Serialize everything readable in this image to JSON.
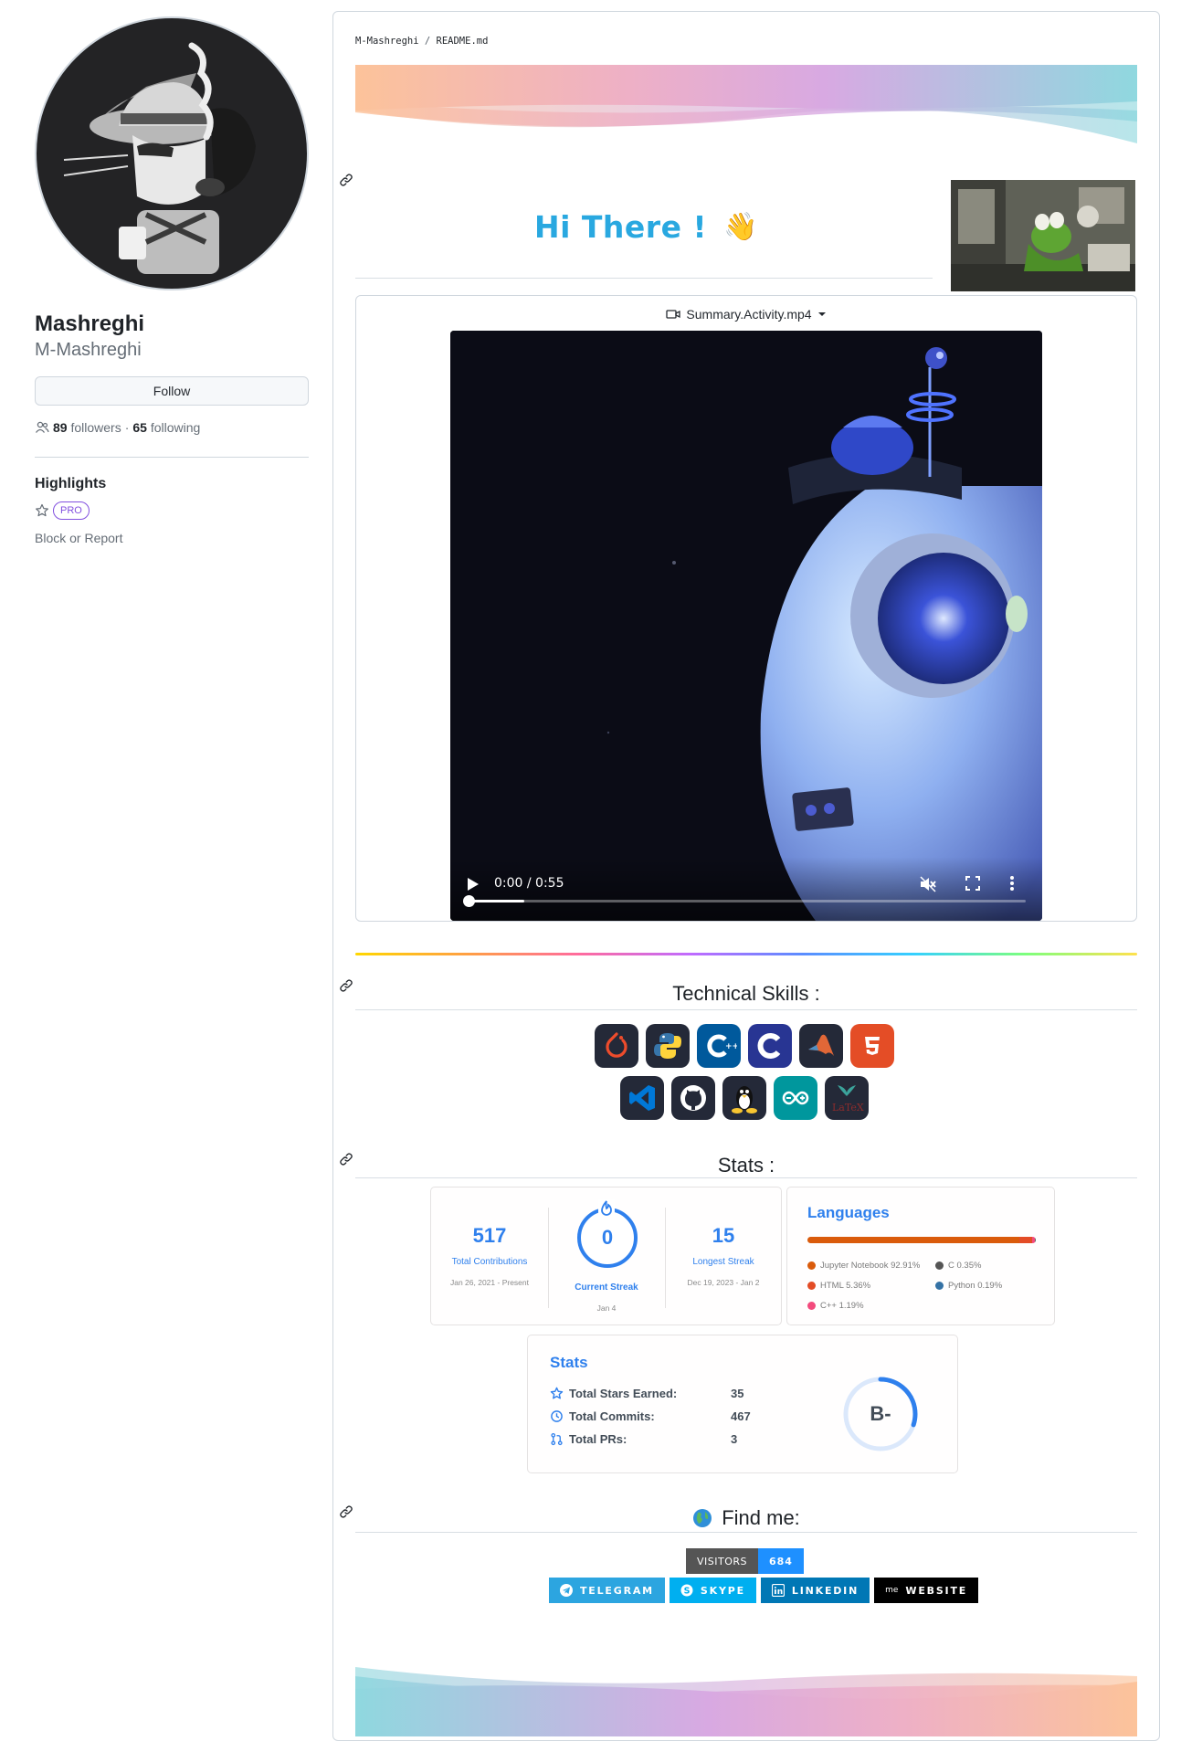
{
  "profile": {
    "name": "Mashreghi",
    "login": "M-Mashreghi",
    "follow_label": "Follow",
    "followers_count": "89",
    "followers_label": "followers",
    "separator": "·",
    "following_count": "65",
    "following_label": "following",
    "highlights_title": "Highlights",
    "pro_badge": "PRO",
    "block_report": "Block or Report"
  },
  "readme": {
    "breadcrumb_owner": "M-Mashreghi",
    "breadcrumb_sep": " / ",
    "breadcrumb_file": "README.md",
    "greeting": "Hi There !",
    "greeting_emoji": "👋",
    "video": {
      "filename": "Summary.Activity.mp4",
      "time": "0:00 / 0:55",
      "progress": 0.1
    },
    "skills_title": "Technical Skills :",
    "skills_row1": [
      "pytorch",
      "python",
      "cpp",
      "c",
      "matlab",
      "html5"
    ],
    "skills_row2": [
      "vscode",
      "github",
      "linux",
      "arduino",
      "latex"
    ],
    "stats_title": "Stats :",
    "streak": {
      "total_contributions": "517",
      "total_contributions_label": "Total Contributions",
      "total_contributions_range": "Jan 26, 2021 - Present",
      "current_streak": "0",
      "current_streak_label": "Current Streak",
      "current_streak_range": "Jan 4",
      "longest_streak": "15",
      "longest_streak_label": "Longest Streak",
      "longest_streak_range": "Dec 19, 2023 - Jan 2"
    },
    "languages": {
      "title": "Languages",
      "items": [
        {
          "name": "Jupyter Notebook 92.91%",
          "percent": 92.91,
          "color": "#DA5B0B"
        },
        {
          "name": "HTML 5.36%",
          "percent": 5.36,
          "color": "#E34C26"
        },
        {
          "name": "C++ 1.19%",
          "percent": 1.19,
          "color": "#F34B7D"
        },
        {
          "name": "C 0.35%",
          "percent": 0.35,
          "color": "#555555"
        },
        {
          "name": "Python 0.19%",
          "percent": 0.19,
          "color": "#3572A5"
        }
      ]
    },
    "github_stats": {
      "title": "Stats",
      "stars_label": "Total Stars Earned:",
      "stars_value": "35",
      "commits_label": "Total Commits:",
      "commits_value": "467",
      "prs_label": "Total PRs:",
      "prs_value": "3",
      "grade": "B-",
      "grade_progress": 0.3
    },
    "findme_title": "Find me:",
    "visitors_label": "VISITORS",
    "visitors_value": "684",
    "social": [
      {
        "label": "TELEGRAM",
        "color": "#2CA5E0"
      },
      {
        "label": "SKYPE",
        "color": "#00AFF0"
      },
      {
        "label": "LINKEDIN",
        "color": "#0077B5"
      },
      {
        "label": "WEBSITE",
        "color": "#000000",
        "prefix": "me"
      }
    ]
  },
  "colors": {
    "accent_blue": "#2f80ed",
    "greeting_color": "#29a8e0",
    "pro_purple": "#8250df"
  }
}
